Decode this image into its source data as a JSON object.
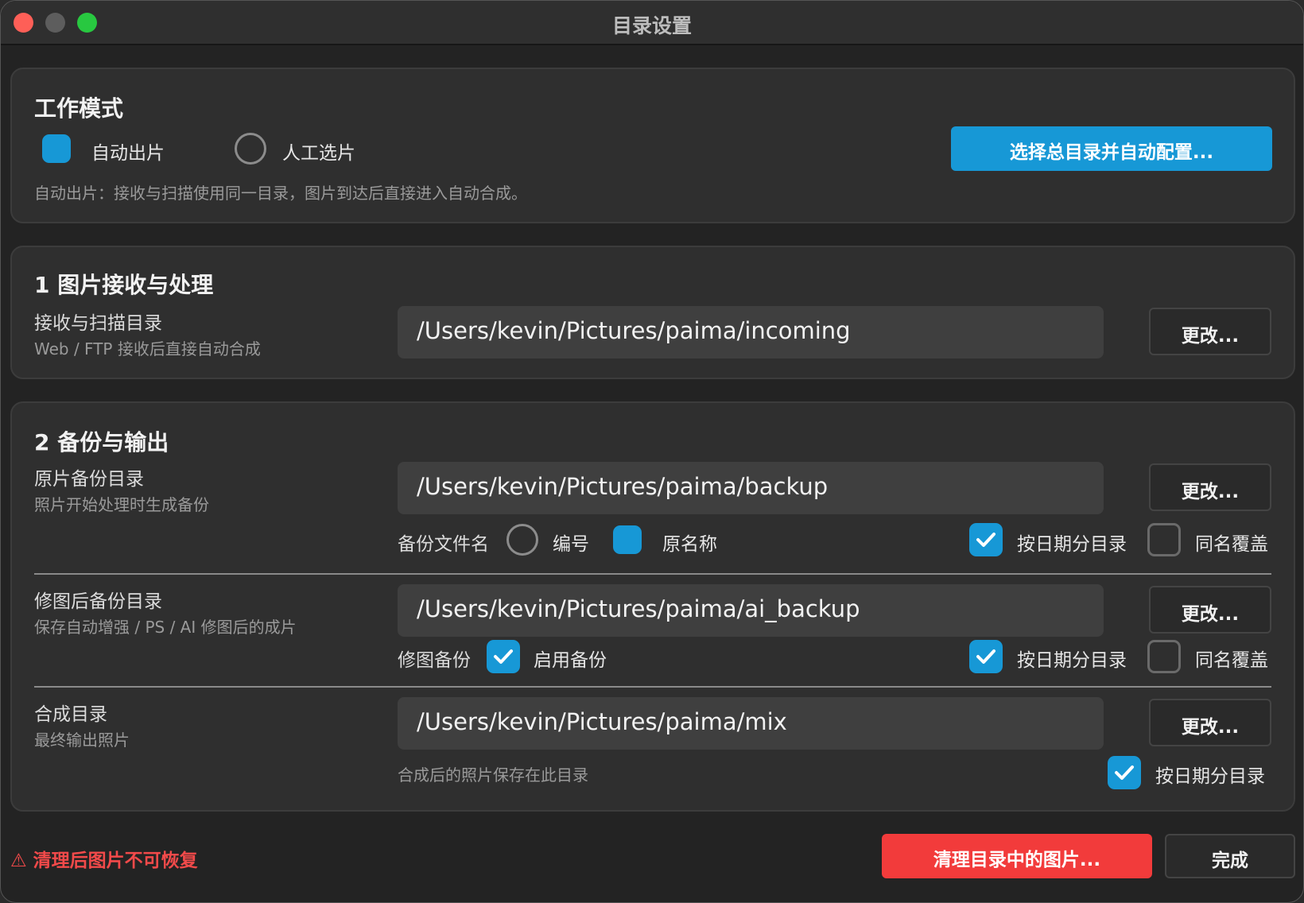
{
  "window": {
    "title": "目录设置"
  },
  "work_mode": {
    "title": "工作模式",
    "options": [
      {
        "label": "自动出片",
        "selected": true
      },
      {
        "label": "人工选片",
        "selected": false
      }
    ],
    "description": "自动出片：接收与扫描使用同一目录，图片到达后直接进入自动合成。",
    "auto_config_button": "选择总目录并自动配置..."
  },
  "section1": {
    "title": "1  图片接收与处理",
    "scan_dir": {
      "label": "接收与扫描目录",
      "sub": "Web / FTP 接收后直接自动合成",
      "path": "/Users/kevin/Pictures/paima/incoming",
      "change_button": "更改..."
    }
  },
  "section2": {
    "title": "2  备份与输出",
    "original_backup": {
      "label": "原片备份目录",
      "sub": "照片开始处理时生成备份",
      "path": "/Users/kevin/Pictures/paima/backup",
      "change_button": "更改...",
      "filename_label": "备份文件名",
      "filename_options": [
        {
          "label": "编号",
          "selected": false
        },
        {
          "label": "原名称",
          "selected": true
        }
      ],
      "by_date": {
        "label": "按日期分目录",
        "checked": true
      },
      "overwrite": {
        "label": "同名覆盖",
        "checked": false
      }
    },
    "retouch_backup": {
      "label": "修图后备份目录",
      "sub": "保存自动增强 / PS / AI 修图后的成片",
      "path": "/Users/kevin/Pictures/paima/ai_backup",
      "change_button": "更改...",
      "backup_label": "修图备份",
      "enable": {
        "label": "启用备份",
        "checked": true
      },
      "by_date": {
        "label": "按日期分目录",
        "checked": true
      },
      "overwrite": {
        "label": "同名覆盖",
        "checked": false
      }
    },
    "mix_dir": {
      "label": "合成目录",
      "sub": "最终输出照片",
      "path": "/Users/kevin/Pictures/paima/mix",
      "change_button": "更改...",
      "note": "合成后的照片保存在此目录",
      "by_date": {
        "label": "按日期分目录",
        "checked": true
      }
    }
  },
  "footer": {
    "warning": "⚠ 清理后图片不可恢复",
    "clean_button": "清理目录中的图片...",
    "done_button": "完成"
  },
  "colors": {
    "accent": "#1798d6",
    "danger": "#f23b3b"
  }
}
